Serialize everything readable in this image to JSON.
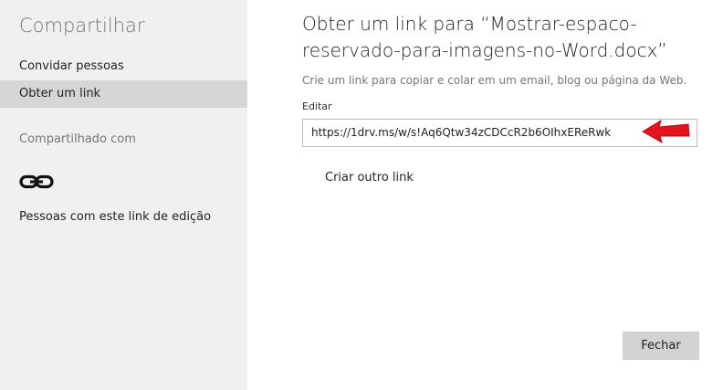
{
  "sidebar": {
    "title": "Compartilhar",
    "items": [
      {
        "label": "Convidar pessoas",
        "selected": false
      },
      {
        "label": "Obter um link",
        "selected": true
      }
    ],
    "shared_with_label": "Compartilhado com",
    "people_link_icon": "link-icon",
    "people_label": "Pessoas com este link de edição"
  },
  "main": {
    "title": "Obter um link para “Mostrar-espaco-reservado-para-imagens-no-Word.docx”",
    "description": "Crie um link para copiar e colar em um email, blog ou página da Web.",
    "edit_label": "Editar",
    "link_value": "https://1drv.ms/w/s!Aq6Qtw34zCDCcR2b6OIhxEReRwk",
    "another_link_label": "Criar outro link",
    "close_label": "Fechar"
  },
  "colors": {
    "sidebar_bg": "#f0f0f0",
    "selected_bg": "#d6d6d6",
    "arrow": "#e3141b",
    "button_bg": "#d3d3d3"
  }
}
